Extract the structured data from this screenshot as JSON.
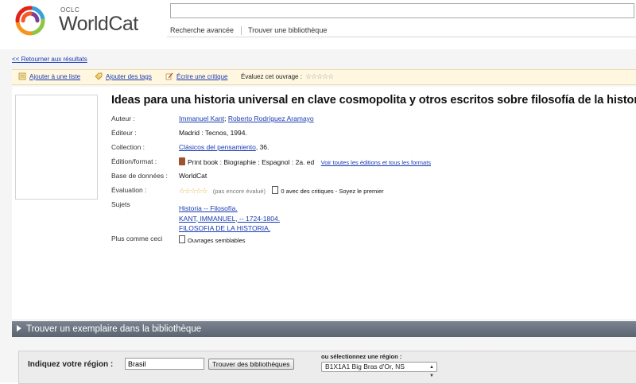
{
  "header": {
    "logo_small": "OCLC",
    "logo_text": "WorldCat",
    "search_value": "",
    "search_placeholder": "",
    "links": [
      "Recherche avancée",
      "Trouver une bibliothèque"
    ]
  },
  "back_link": "<< Retourner aux résultats",
  "actions": {
    "add_list": "Ajouter à une liste",
    "add_tags": "Ajouter des tags",
    "write_review": "Écrire une critique",
    "rate_label": "Évaluez cet ouvrage :",
    "rating_stars": "☆☆☆☆☆"
  },
  "record": {
    "title": "Ideas para una historia universal en clave cosmopolita y otros escritos sobre filosofía de la historia",
    "labels": {
      "author": "Auteur :",
      "publisher": "Éditeur :",
      "collection": "Collection :",
      "edition": "Édition/format :",
      "database": "Base de données :",
      "evaluation": "Évaluation :",
      "subjects": "Sujets",
      "more": "Plus comme ceci"
    },
    "authors": [
      "Immanuel Kant",
      "Roberto Rodríguez Aramayo"
    ],
    "author_sep": ";",
    "publisher": "Madrid : Tecnos, 1994.",
    "collection_link": "Clásicos del pensamiento",
    "collection_number": ", 36.",
    "edition": "Print book : Biographie : Espagnol : 2a. ed",
    "edition_link": "Voir toutes les éditions et tous les formats",
    "database": "WorldCat",
    "eval_stars": "☆☆☆☆☆",
    "eval_status": "(pas encore évalué)",
    "eval_reviews": "0 avec des critiques - Soyez le premier",
    "subjects": [
      "Historia -- Filosofía.",
      "KANT, IMMANUEL, -- 1724-1804.",
      "FILOSOFIA DE LA HISTORIA."
    ],
    "similar_link": "Ouvrages semblables"
  },
  "find": {
    "bar_title": "Trouver un exemplaire dans la bibliothèque",
    "region_label": "Indiquez votre région :",
    "region_value": "Brasil",
    "find_button": "Trouver des bibliothèques",
    "or_label": "ou sélectionnez une région :",
    "region_select": "B1X1A1 Big Bras d'Or, NS"
  },
  "colors": {
    "link": "#1a3bb3",
    "action_bar": "#fff7e0",
    "section_bar": "#5a6370",
    "star": "#e3a73a"
  }
}
